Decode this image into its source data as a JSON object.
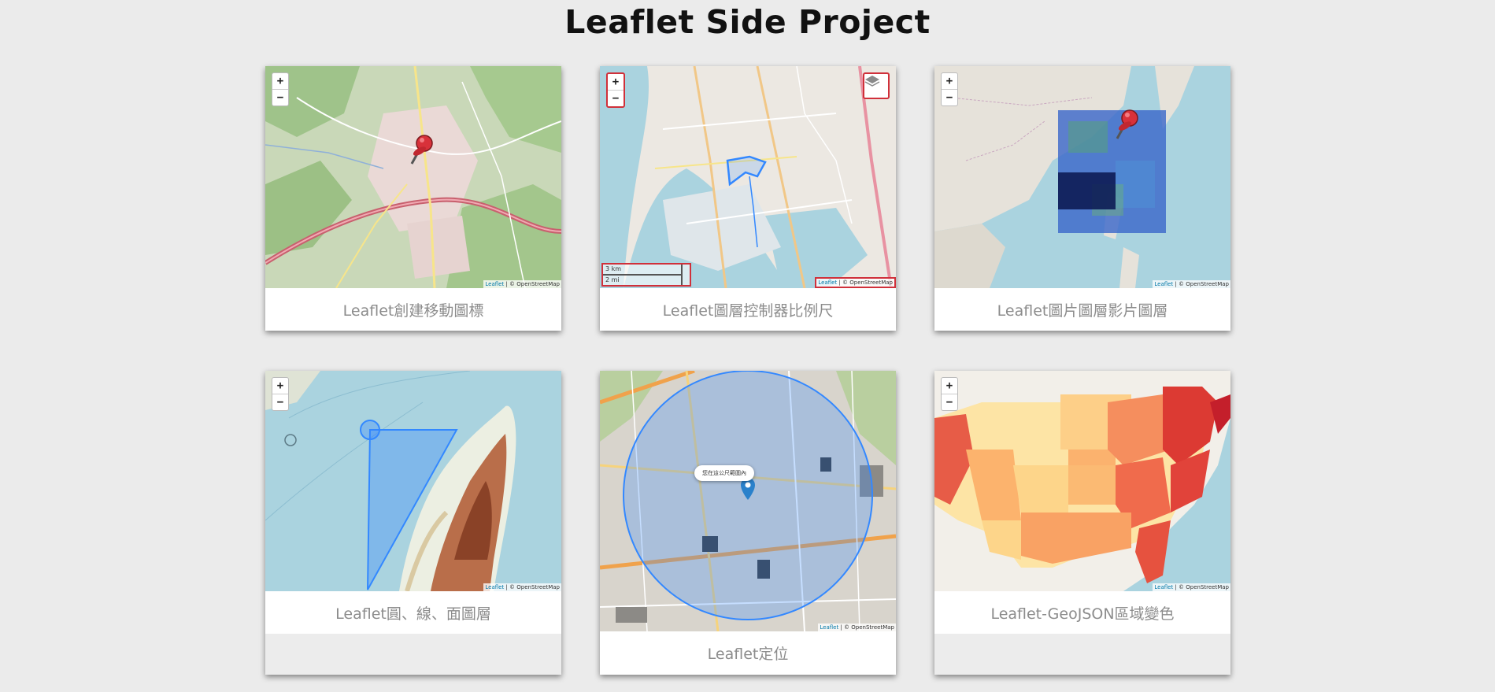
{
  "page": {
    "title": "Leaflet Side Project"
  },
  "cards": [
    {
      "caption": "Leaflet創建移動圖標"
    },
    {
      "caption": "Leaflet圖層控制器比例尺"
    },
    {
      "caption": "Leaflet圖片圖層影片圖層"
    },
    {
      "caption": "Leaflet圓、線、面圖層"
    },
    {
      "caption": "Leaflet定位"
    },
    {
      "caption": "Leaflet-GeoJSON區域變色"
    }
  ],
  "map_controls": {
    "zoom_in": "+",
    "zoom_out": "−"
  },
  "attribution": {
    "leaflet": "Leaflet",
    "rest": " | © OpenStreetMap"
  },
  "scale": {
    "metric": "3 km",
    "imperial": "2 mi"
  },
  "locate_popup": "您在這公尺範圍內"
}
